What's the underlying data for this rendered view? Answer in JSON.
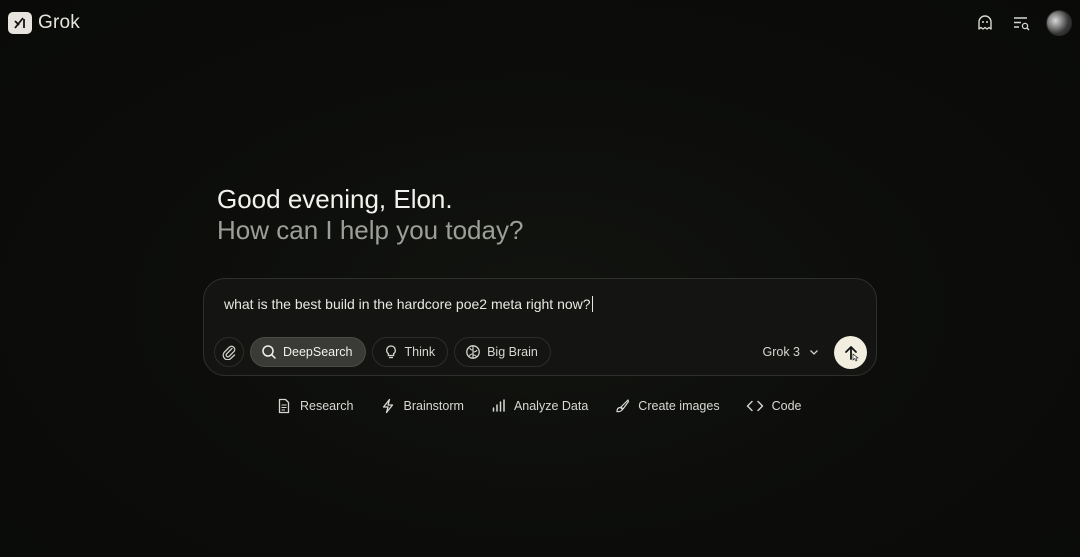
{
  "app": {
    "name": "Grok",
    "logo_icon": "grok-logo-icon"
  },
  "header": {
    "icons": [
      "ghost-icon",
      "history-icon",
      "avatar"
    ]
  },
  "greeting": {
    "line1": "Good evening, Elon.",
    "line2": "How can I help you today?"
  },
  "composer": {
    "input_value": "what is the best build in the hardcore poe2 meta right now?",
    "attach_icon": "paperclip-icon",
    "modes": [
      {
        "label": "DeepSearch",
        "icon": "search-icon",
        "active": true
      },
      {
        "label": "Think",
        "icon": "lightbulb-icon",
        "active": false
      },
      {
        "label": "Big Brain",
        "icon": "brain-icon",
        "active": false
      }
    ],
    "model": "Grok 3",
    "send_icon": "arrow-up-icon"
  },
  "suggestions": [
    {
      "label": "Research",
      "icon": "document-icon"
    },
    {
      "label": "Brainstorm",
      "icon": "lightning-icon"
    },
    {
      "label": "Analyze Data",
      "icon": "bar-chart-icon"
    },
    {
      "label": "Create images",
      "icon": "paintbrush-icon"
    },
    {
      "label": "Code",
      "icon": "code-icon"
    }
  ],
  "colors": {
    "background": "#0b0c0a",
    "send_button": "#f1eee0",
    "active_pill": "#3a3b37"
  }
}
